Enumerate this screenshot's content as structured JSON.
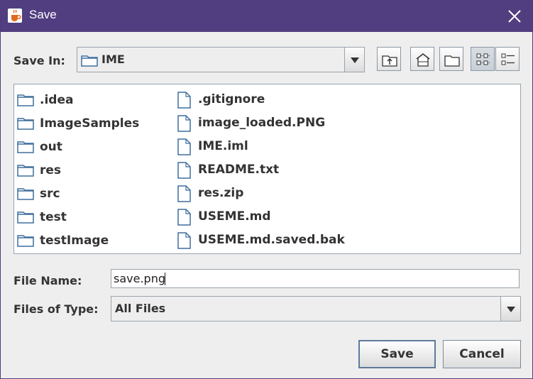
{
  "window": {
    "title": "Save"
  },
  "toolbar": {
    "save_in_label": "Save In:",
    "save_in_value": "IME"
  },
  "files": {
    "col1": [
      ".idea",
      "ImageSamples",
      "out",
      "res",
      "src",
      "test",
      "testImage"
    ],
    "col2": [
      ".gitignore",
      "image_loaded.PNG",
      "IME.iml",
      "README.txt",
      "res.zip",
      "USEME.md",
      "USEME.md.saved.bak"
    ]
  },
  "form": {
    "file_name_label": "File Name:",
    "file_name_value": "save.png",
    "files_of_type_label": "Files of Type:",
    "files_of_type_value": "All Files"
  },
  "buttons": {
    "save": "Save",
    "cancel": "Cancel"
  },
  "icons": {
    "app": "java-coffee-icon",
    "close": "close-icon",
    "folder": "folder-icon",
    "file": "file-icon",
    "up_one_level": "up-folder-icon",
    "home": "home-icon",
    "new_folder": "new-folder-icon",
    "list_view": "list-view-icon",
    "details_view": "details-view-icon"
  },
  "colors": {
    "titlebar": "#513e80",
    "background": "#eeeeee",
    "folder": "#3f6e9e"
  }
}
